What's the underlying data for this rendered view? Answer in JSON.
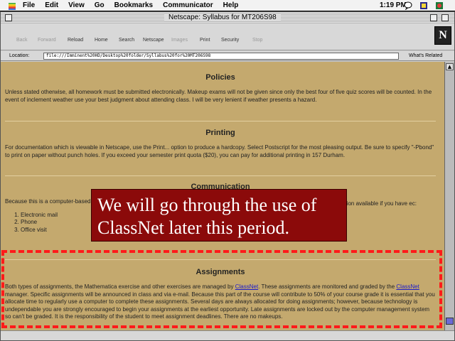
{
  "menubar": {
    "items": [
      "File",
      "Edit",
      "View",
      "Go",
      "Bookmarks",
      "Communicator",
      "Help"
    ],
    "clock": "1:19 PM"
  },
  "window": {
    "title": "Netscape: Syllabus for MT206S98"
  },
  "toolbar": {
    "buttons": [
      "Back",
      "Forward",
      "Reload",
      "Home",
      "Search",
      "Netscape",
      "Images",
      "Print",
      "Security",
      "Stop"
    ],
    "logo": "N"
  },
  "location": {
    "label": "Location:",
    "url": "file:///Imminent%20HD/Desktop%20folder/Syllabus%20for%20MT206S98",
    "related": "What's Related"
  },
  "sections": {
    "policies": {
      "heading": "Policies",
      "text": "Unless stated otherwise, all homework must be submitted electronically. Makeup exams will not be given since only the best four of five quiz scores will be counted. In the event of inclement weather use your best judgment about attending class. I will be very lenient if weather presents a hazard."
    },
    "printing": {
      "heading": "Printing",
      "text": "For documentation which is viewable in Netscape, use the Print... option to produce a hardcopy. Select Postscript for the most pleasing output. Be sure to specify \"-Pbond\" to print on paper without punch holes. If you exceed your semester print quota ($20), you can pay for additional printing in 157 Durham."
    },
    "communication": {
      "heading": "Communication",
      "text_start": "Because this is a computer-based course, problems or questions, we will",
      "text_end": "ation available if you have ec:",
      "list": [
        "Electronic mail",
        "Phone",
        "Office visit"
      ]
    },
    "assignments": {
      "heading": "Assignments",
      "text_1": "Both types of assignments, the Mathematica exercise and other exercises are managed by ",
      "link_1": "ClassNet",
      "text_2": ". These assignments are monitored and graded by the ",
      "link_2": "ClassNet",
      "text_3": " manager. Specific assignments will be announced in class and via e-mail. Because this part of the course will contribute to 50% of your course grade it is essential that you allocate time to regularly use a computer to complete these assignments. Several days are always allocated for doing assignments; however, because technology is undependable you are strongly encouraged to begin your assignments at the earliest opportunity. Late assignments are locked out by the computer management system so can't be graded. It is the responsibility of the student to meet assignment deadlines. There are no makeups."
    }
  },
  "overlay": {
    "callout": "We will go through the use of ClassNet later this period."
  },
  "colors": {
    "page_background": "#c4a96e",
    "callout_background": "#8b0a0a",
    "highlight_border": "#ff1a1a",
    "link": "#1a1acc"
  }
}
